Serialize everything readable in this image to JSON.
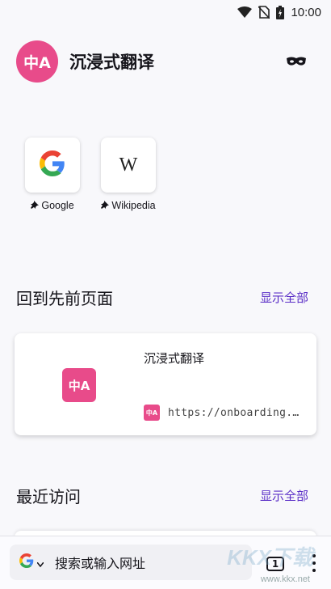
{
  "status_bar": {
    "time": "10:00",
    "icons": [
      "wifi-icon",
      "no-sim-icon",
      "battery-charging-icon"
    ]
  },
  "header": {
    "logo_text": "中A",
    "app_name": "沉浸式翻译",
    "private_mode_icon": "mask-icon"
  },
  "shortcuts": [
    {
      "label": "Google",
      "icon": "google-icon",
      "pin_icon": "pin-icon"
    },
    {
      "label": "Wikipedia",
      "icon": "wikipedia-icon",
      "tile_text": "W",
      "pin_icon": "pin-icon"
    }
  ],
  "jump_back": {
    "title": "回到先前页面",
    "show_all": "显示全部",
    "card": {
      "title": "沉浸式翻译",
      "thumb_text": "中A",
      "url": "https://onboarding.im…",
      "favicon_text": "中A"
    }
  },
  "recent": {
    "title": "最近访问",
    "show_all": "显示全部"
  },
  "toolbar": {
    "search_placeholder": "搜索或输入网址",
    "tabs_count": "1",
    "engine_icon": "google-icon"
  },
  "watermark": {
    "text": "www.kkx.net",
    "logo": "KKX下载"
  },
  "colors": {
    "accent": "#5b2fc7",
    "brand_pink": "#e84b8a",
    "background": "#f8f8fb"
  }
}
